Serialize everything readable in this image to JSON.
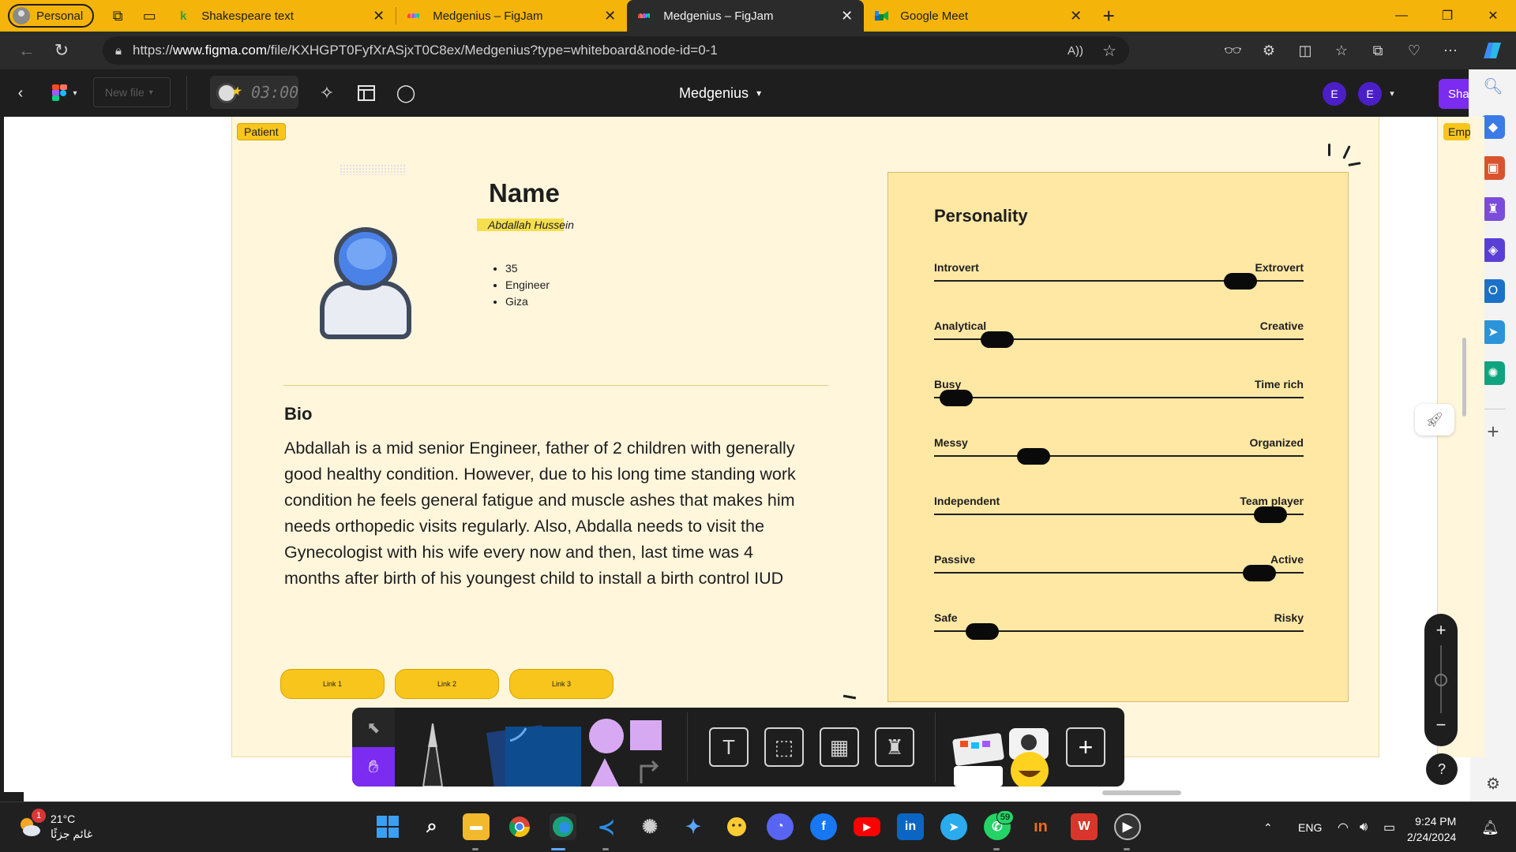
{
  "browser": {
    "profile_label": "Personal",
    "tabs": [
      {
        "title": "Shakespeare text",
        "favicon": "k-icon",
        "active": false
      },
      {
        "title": "Medgenius – FigJam",
        "favicon": "figma-icon",
        "active": false
      },
      {
        "title": "Medgenius – FigJam",
        "favicon": "figma-icon",
        "active": true
      },
      {
        "title": "Google Meet",
        "favicon": "google-meet-icon",
        "active": false
      }
    ],
    "url_prefix": "https://",
    "url_host": "www.figma.com",
    "url_path": "/file/KXHGPT0FyfXrASjxT0C8ex/Medgenius?type=whiteboard&node-id=0-1"
  },
  "figma": {
    "new_file_label": "New file",
    "timer_value": "03:00",
    "doc_title": "Medgenius",
    "users": [
      "E",
      "E"
    ],
    "share_label": "Share"
  },
  "canvas": {
    "section_label": "Patient",
    "next_section_label": "Emp",
    "name_heading": "Name",
    "name_value": "Abdallah Hussein",
    "facts": [
      "35",
      "Engineer",
      "Giza"
    ],
    "bio_heading": "Bio",
    "bio_text": "Abdallah is a mid senior Engineer, father of 2 children with generally good healthy condition. However, due to his long time standing work condition he feels general fatigue and muscle ashes that makes him needs orthopedic visits regularly. Also, Abdalla needs to visit the Gynecologist with his wife every now and then, last time was 4 months after birth of his youngest child to install a birth control IUD",
    "links": [
      "Link 1",
      "Link 2",
      "Link 3"
    ],
    "personality": {
      "title": "Personality",
      "traits": [
        {
          "left": "Introvert",
          "right": "Extrovert",
          "value": 0.83
        },
        {
          "left": "Analytical",
          "right": "Creative",
          "value": 0.17
        },
        {
          "left": "Busy",
          "right": "Time rich",
          "value": 0.06
        },
        {
          "left": "Messy",
          "right": "Organized",
          "value": 0.27
        },
        {
          "left": "Independent",
          "right": "Team player",
          "value": 0.91
        },
        {
          "left": "Passive",
          "right": "Active",
          "value": 0.88
        },
        {
          "left": "Safe",
          "right": "Risky",
          "value": 0.13
        }
      ]
    }
  },
  "taskbar": {
    "temperature": "21°C",
    "weather_text": "غائم جزئًا",
    "weather_badge": "1",
    "whatsapp_badge": "59",
    "language": "ENG",
    "time": "9:24 PM",
    "date": "2/24/2024"
  },
  "colors": {
    "browser_accent": "#f5b40a",
    "section_bg": "#fff6dc",
    "sticky_yellow": "#f7c51c",
    "personality_card": "#ffe8a4",
    "share_purple": "#7b2cf0"
  }
}
